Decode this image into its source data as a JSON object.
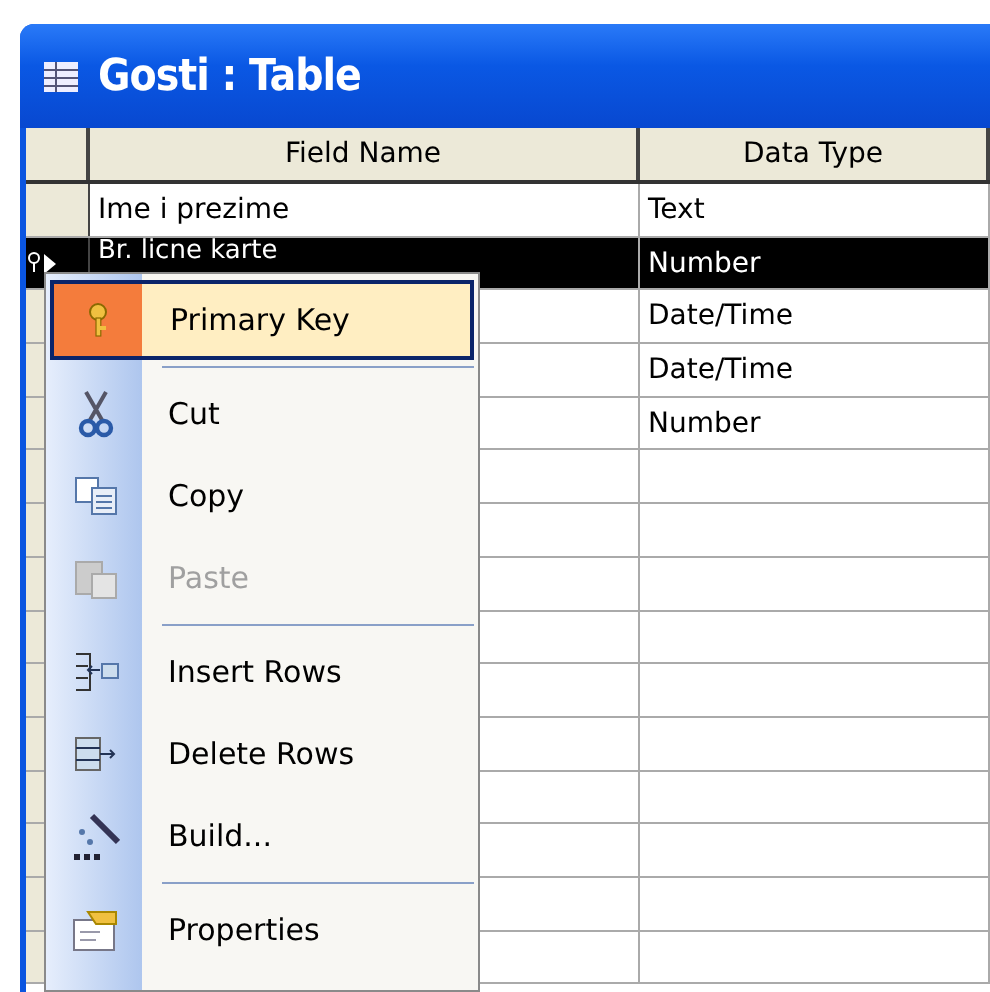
{
  "window": {
    "title": "Gosti : Table"
  },
  "table": {
    "columns": [
      "Field Name",
      "Data Type"
    ],
    "rows": [
      {
        "field_name": "Ime i prezime",
        "data_type": "Text",
        "selected": false,
        "primary_key": false
      },
      {
        "field_name": "Br. licne karte",
        "data_type": "Number",
        "selected": true,
        "primary_key": true
      },
      {
        "field_name": "",
        "data_type": "Date/Time",
        "selected": false,
        "primary_key": false
      },
      {
        "field_name": "",
        "data_type": "Date/Time",
        "selected": false,
        "primary_key": false
      },
      {
        "field_name": "",
        "data_type": "Number",
        "selected": false,
        "primary_key": false
      },
      {
        "field_name": "",
        "data_type": "",
        "selected": false,
        "primary_key": false
      },
      {
        "field_name": "",
        "data_type": "",
        "selected": false,
        "primary_key": false
      },
      {
        "field_name": "",
        "data_type": "",
        "selected": false,
        "primary_key": false
      },
      {
        "field_name": "",
        "data_type": "",
        "selected": false,
        "primary_key": false
      },
      {
        "field_name": "",
        "data_type": "",
        "selected": false,
        "primary_key": false
      },
      {
        "field_name": "",
        "data_type": "",
        "selected": false,
        "primary_key": false
      },
      {
        "field_name": "",
        "data_type": "",
        "selected": false,
        "primary_key": false
      },
      {
        "field_name": "",
        "data_type": "",
        "selected": false,
        "primary_key": false
      },
      {
        "field_name": "",
        "data_type": "",
        "selected": false,
        "primary_key": false
      },
      {
        "field_name": "",
        "data_type": "",
        "selected": false,
        "primary_key": false
      }
    ]
  },
  "context_menu": {
    "items": [
      {
        "kind": "key",
        "label": "Primary Key",
        "selected": true,
        "disabled": false,
        "separator_after": true
      },
      {
        "kind": "cut",
        "label": "Cut",
        "selected": false,
        "disabled": false,
        "separator_after": false
      },
      {
        "kind": "copy",
        "label": "Copy",
        "selected": false,
        "disabled": false,
        "separator_after": false
      },
      {
        "kind": "paste",
        "label": "Paste",
        "selected": false,
        "disabled": true,
        "separator_after": true
      },
      {
        "kind": "insert",
        "label": "Insert Rows",
        "selected": false,
        "disabled": false,
        "separator_after": false
      },
      {
        "kind": "delete",
        "label": "Delete Rows",
        "selected": false,
        "disabled": false,
        "separator_after": false
      },
      {
        "kind": "build",
        "label": "Build...",
        "selected": false,
        "disabled": false,
        "separator_after": true
      },
      {
        "kind": "properties",
        "label": "Properties",
        "selected": false,
        "disabled": false,
        "separator_after": false
      }
    ]
  }
}
